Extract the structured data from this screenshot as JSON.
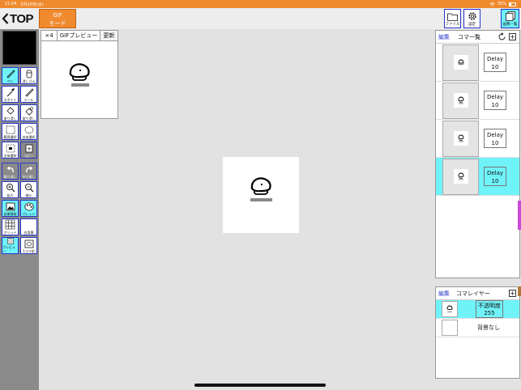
{
  "status": {
    "time": "21:04",
    "date": "5月20日(水)",
    "battery": "35%"
  },
  "nav": {
    "back_label": "TOP",
    "mode_line1": "GIF",
    "mode_line2": "モード"
  },
  "topbar": {
    "file_label": "ファイル",
    "settings_label": "設定",
    "frame_list_label": "画像一覧"
  },
  "tools": {
    "pen": "ペン",
    "eraser": "消しゴム",
    "eyedropper": "スポイト",
    "tool": "ツール",
    "fill": "塗り潰し",
    "fill2": "塗り潰し",
    "rect_select": "範囲選択",
    "free_select": "自由選択",
    "select_all": "全体選択",
    "copy": "コピー",
    "undo": "取り消し",
    "redo": "やり直し",
    "zoom_in": "拡大",
    "zoom_out": "縮小",
    "image_info": "画像情報",
    "palette": "パレット",
    "grid": "グリッド",
    "background": "白背景",
    "preview": "プレビュー",
    "one_frame": "1コマ前"
  },
  "gif_preview": {
    "scale": "×4",
    "title": "GIFプレビュー",
    "refresh": "更新"
  },
  "frames_panel": {
    "edit": "編集",
    "title": "コマ一覧",
    "frames": [
      {
        "delay_label": "Delay",
        "delay": "10",
        "selected": false
      },
      {
        "delay_label": "Delay",
        "delay": "10",
        "selected": false
      },
      {
        "delay_label": "Delay",
        "delay": "10",
        "selected": false
      },
      {
        "delay_label": "Delay",
        "delay": "10",
        "selected": true
      }
    ]
  },
  "layers_panel": {
    "edit": "編集",
    "title": "コマレイヤー",
    "layers": [
      {
        "label": "不透明度",
        "value": "255",
        "selected": true
      },
      {
        "label": "背景なし",
        "value": "",
        "selected": false
      }
    ]
  },
  "colors": {
    "accent": "#f08a2e",
    "selected": "#6ff3f8",
    "tool_border": "#2a39c9"
  }
}
